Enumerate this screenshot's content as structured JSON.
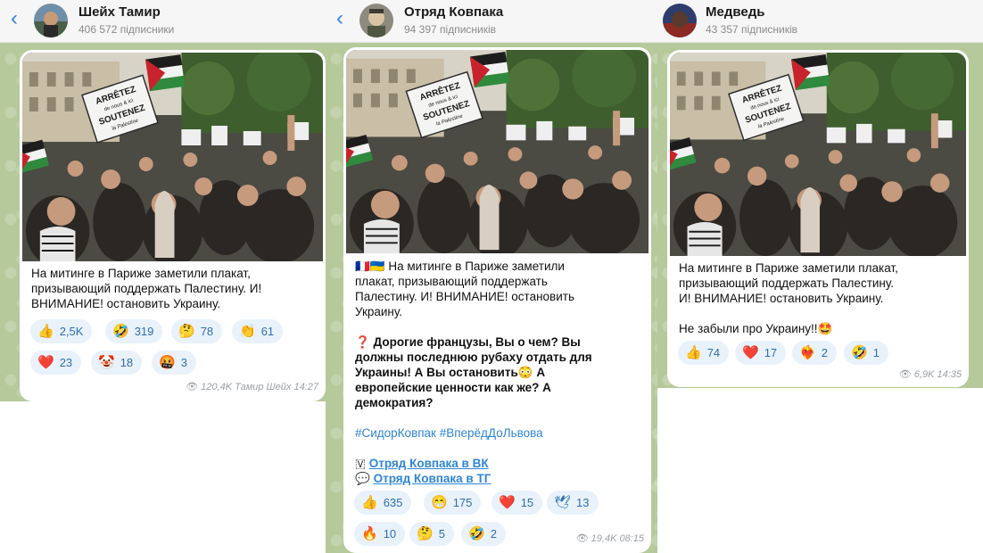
{
  "channels": [
    {
      "title": "Шейх Тамир",
      "subscribers": "406 572 підписники",
      "message": {
        "text_lines": [
          "На митинге в Париже заметили плакат,",
          "призывающий поддержать Палестину. И!",
          "ВНИМАНИЕ! остановить Украину."
        ]
      },
      "reactions": [
        {
          "emoji": "👍",
          "count": "2,5K"
        },
        {
          "emoji": "🤣",
          "count": "319"
        },
        {
          "emoji": "🤔",
          "count": "78"
        },
        {
          "emoji": "👏",
          "count": "61"
        },
        {
          "emoji": "❤️",
          "count": "23"
        },
        {
          "emoji": "🤡",
          "count": "18"
        },
        {
          "emoji": "🤬",
          "count": "3"
        }
      ],
      "views": "120,4K",
      "signature": "Тамир Шейх",
      "time": "14:27"
    },
    {
      "title": "Отряд Ковпака",
      "subscribers": "94 397 підписників",
      "message": {
        "intro_lines": [
          "🇫🇷🇺🇦 На митинге в Париже заметили",
          "плакат, призывающий поддержать",
          "Палестину. И! ВНИМАНИЕ! остановить",
          "Украину."
        ],
        "question_lines": [
          "❓ Дорогие французы, Вы о чем? Вы",
          "должны последнюю рубаху отдать для",
          "Украины! А Вы остановить😳 А",
          "европейские ценности как же? А",
          "демократия?"
        ],
        "hashtags": "#СидорКовпак #ВперёдДоЛьвова",
        "link_vk": "Отряд Ковпака в ВК",
        "link_tg": "Отряд Ковпака в ТГ",
        "vk_icon": "🇻",
        "tg_icon": "💬"
      },
      "reactions": [
        {
          "emoji": "👍",
          "count": "635"
        },
        {
          "emoji": "😁",
          "count": "175"
        },
        {
          "emoji": "❤️",
          "count": "15"
        },
        {
          "emoji": "🕊",
          "count": "13"
        },
        {
          "emoji": "🔥",
          "count": "10"
        },
        {
          "emoji": "🤔",
          "count": "5"
        },
        {
          "emoji": "🤣",
          "count": "2"
        }
      ],
      "views": "19,4K",
      "time": "08:15"
    },
    {
      "title": "Медведь",
      "subscribers": "43 357 підписників",
      "message": {
        "text_lines": [
          "На митинге в Париже заметили плакат,",
          "призывающий поддержать Палестину.",
          "И! ВНИМАНИЕ! остановить Украину."
        ],
        "extra": "Не забыли про Украину!!🤩"
      },
      "reactions": [
        {
          "emoji": "👍",
          "count": "74"
        },
        {
          "emoji": "❤️",
          "count": "17"
        },
        {
          "emoji": "❤️‍🔥",
          "count": "2"
        },
        {
          "emoji": "🤣",
          "count": "1"
        }
      ],
      "views": "6,9K",
      "time": "14:35"
    }
  ],
  "photo": {
    "sign_lines": [
      "ARRÊTEZ",
      "de nous & ici",
      "SOUTENEZ",
      "la Palestine"
    ]
  },
  "icons": {
    "back": "chevron-left-icon",
    "views": "eye-icon"
  },
  "colors": {
    "link": "#2f86d6",
    "reaction_bg": "#e9f2fb",
    "wallpaper": "#b6c99b"
  }
}
